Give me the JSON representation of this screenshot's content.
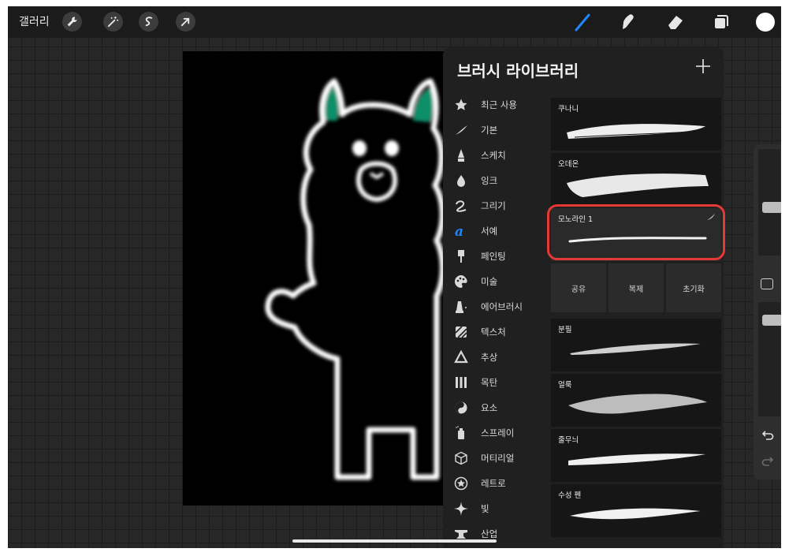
{
  "topbar": {
    "gallery_label": "갤러리",
    "left_tools": [
      "wrench-icon",
      "magic-wand-icon",
      "selection-icon",
      "transform-arrow-icon"
    ],
    "right_tools": [
      "brush-icon",
      "smudge-icon",
      "eraser-icon",
      "layers-icon"
    ],
    "current_color": "#ffffff",
    "accent_color": "#1e88ff"
  },
  "panel": {
    "title": "브러시 라이브러리",
    "add_symbol": "+",
    "categories": [
      {
        "label": "최근 사용",
        "icon": "star-icon"
      },
      {
        "label": "기본",
        "icon": "stroke-icon"
      },
      {
        "label": "스케치",
        "icon": "pencil-icon"
      },
      {
        "label": "잉크",
        "icon": "ink-drop-icon"
      },
      {
        "label": "그리기",
        "icon": "loop-icon"
      },
      {
        "label": "서예",
        "icon": "calligraphy-icon"
      },
      {
        "label": "페인팅",
        "icon": "paint-brush-icon"
      },
      {
        "label": "미술",
        "icon": "palette-icon"
      },
      {
        "label": "에어브러시",
        "icon": "airbrush-icon"
      },
      {
        "label": "텍스처",
        "icon": "texture-icon"
      },
      {
        "label": "추상",
        "icon": "triangle-icon"
      },
      {
        "label": "목탄",
        "icon": "charcoal-icon"
      },
      {
        "label": "요소",
        "icon": "yin-yang-icon"
      },
      {
        "label": "스프레이",
        "icon": "spray-can-icon"
      },
      {
        "label": "머티리얼",
        "icon": "cube-icon"
      },
      {
        "label": "레트로",
        "icon": "retro-star-icon"
      },
      {
        "label": "빛",
        "icon": "sparkle-icon"
      },
      {
        "label": "산업",
        "icon": "anvil-icon"
      }
    ],
    "selected_category": "서예",
    "brushes_top": [
      {
        "name": "쿠나니"
      },
      {
        "name": "오데온"
      },
      {
        "name": "모노라인 1"
      }
    ],
    "selected_brush": "모노라인 1",
    "actions": {
      "share": "공유",
      "duplicate": "복제",
      "reset": "초기화"
    },
    "brushes_bottom": [
      {
        "name": "분필"
      },
      {
        "name": "얼룩"
      },
      {
        "name": "줄무늬"
      },
      {
        "name": "수성 펜"
      }
    ],
    "highlight_color": "#e53935"
  },
  "sidebar": {
    "brush_size_level": 0.45,
    "opacity_level": 0.88
  }
}
